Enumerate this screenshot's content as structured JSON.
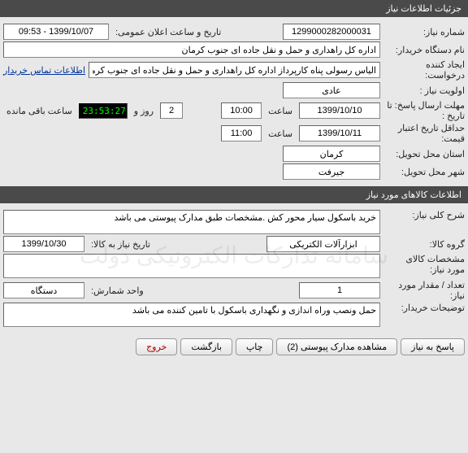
{
  "need_info": {
    "header": "جزئیات اطلاعات نیاز",
    "need_no_label": "شماره نیاز:",
    "need_no": "1299000282000031",
    "announce_label": "تاریخ و ساعت اعلان عمومی:",
    "announce": "1399/10/07 - 09:53",
    "buyer_org_label": "نام دستگاه خریدار:",
    "buyer_org": "اداره کل راهداری و حمل و نقل جاده ای جنوب کرمان",
    "creator_label": "ایجاد کننده درخواست:",
    "creator": "الیاس رسولی پناه کارپرداز اداره کل راهداری و حمل و نقل جاده ای جنوب کرمان",
    "buyer_contact": "اطلاعات تماس خریدار",
    "priority_label": "اولویت نیاز :",
    "priority": "عادی",
    "deadline_label": "مهلت ارسال پاسخ:",
    "until_label": "تا تاریخ :",
    "date1": "1399/10/10",
    "time_lbl": "ساعت",
    "time1": "10:00",
    "days": "2",
    "days_suffix": "روز و",
    "countdown": "23:53:27",
    "remain": "ساعت باقی مانده",
    "min_credit_label": "حداقل تاریخ اعتبار قیمت:",
    "date2": "1399/10/11",
    "time2": "11:00",
    "province_label": "استان محل تحویل:",
    "province": "کرمان",
    "city_label": "شهر محل تحویل:",
    "city": "جیرفت"
  },
  "goods": {
    "header": "اطلاعات کالاهای مورد نیاز",
    "general_desc_label": "شرح کلی نیاز:",
    "general_desc": "خرید باسکول سیار محور کش .مشخصات طبق مدارک پیوستی می باشد",
    "group_label": "گروه کالا:",
    "group": "ابزارآلات الکتریکی",
    "need_date_label": "تاریخ نیاز به کالا:",
    "need_date": "1399/10/30",
    "spec_label": "مشخصات کالای مورد نیاز:",
    "spec": "",
    "qty_label": "تعداد / مقدار مورد نیاز:",
    "qty": "1",
    "unit_label": "واحد شمارش:",
    "unit": "دستگاه",
    "buyer_notes_label": "توضیحات خریدار:",
    "buyer_notes": "حمل ونصب وراه اندازی و نگهداری باسکول با تامین کننده می باشد"
  },
  "buttons": {
    "respond": "پاسخ به نیاز",
    "view_attach": "مشاهده مدارک پیوستی (2)",
    "print": "چاپ",
    "back": "بازگشت",
    "exit": "خروج"
  },
  "watermark": "سامانه تدارکات الکترونیکی دولت"
}
